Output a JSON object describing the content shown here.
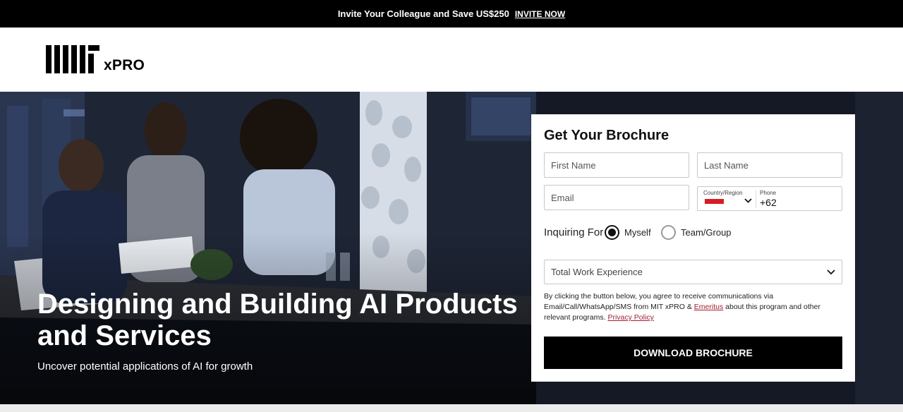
{
  "promo": {
    "text": "Invite Your Colleague and Save US$250",
    "link": "INVITE NOW"
  },
  "header": {
    "logo_mit": "MIT",
    "logo_xpro": "xPRO"
  },
  "hero": {
    "title": "Designing and Building AI Products and Services",
    "subtitle": "Uncover potential applications of AI for growth"
  },
  "form": {
    "title": "Get Your Brochure",
    "first_name_placeholder": "First Name",
    "last_name_placeholder": "Last Name",
    "email_placeholder": "Email",
    "country_label": "Country/Region",
    "phone_label": "Phone",
    "phone_code": "+62",
    "inquiring_label": "Inquiring For",
    "option_myself": "Myself",
    "option_team": "Team/Group",
    "selected_option": "Myself",
    "experience_placeholder": "Total Work Experience",
    "consent_part1": "By clicking the button below, you agree to receive communications via Email/Call/WhatsApp/SMS from MIT xPRO & ",
    "consent_link_emeritus": "Emeritus",
    "consent_part2": " about this program and other relevant programs. ",
    "consent_link_privacy": "Privacy Policy",
    "submit_label": "DOWNLOAD BROCHURE"
  },
  "colors": {
    "promo_bg": "#000000",
    "link_accent": "#a31f34",
    "flag_red": "#d51d24",
    "button_bg": "#000000"
  }
}
